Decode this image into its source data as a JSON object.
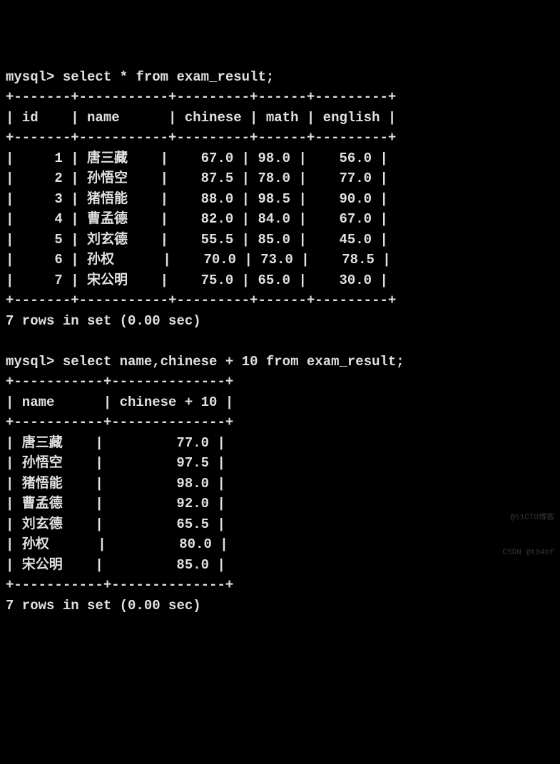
{
  "query1": {
    "prompt": "mysql> ",
    "sql": "select * from exam_result;",
    "border_top": "+-------+-----------+---------+------+---------+",
    "header_line": "| id    | name      | chinese | math | english |",
    "border_mid": "+-------+-----------+---------+------+---------+",
    "rows": [
      "|     1 | 唐三藏    |    67.0 | 98.0 |    56.0 |",
      "|     2 | 孙悟空    |    87.5 | 78.0 |    77.0 |",
      "|     3 | 猪悟能    |    88.0 | 98.5 |    90.0 |",
      "|     4 | 曹孟德    |    82.0 | 84.0 |    67.0 |",
      "|     5 | 刘玄德    |    55.5 | 85.0 |    45.0 |",
      "|     6 | 孙权      |    70.0 | 73.0 |    78.5 |",
      "|     7 | 宋公明    |    75.0 | 65.0 |    30.0 |"
    ],
    "border_bot": "+-------+-----------+---------+------+---------+",
    "status": "7 rows in set (0.00 sec)"
  },
  "query2": {
    "prompt": "mysql> ",
    "sql": "select name,chinese + 10 from exam_result;",
    "border_top": "+-----------+--------------+",
    "header_line": "| name      | chinese + 10 |",
    "border_mid": "+-----------+--------------+",
    "rows": [
      "| 唐三藏    |         77.0 |",
      "| 孙悟空    |         97.5 |",
      "| 猪悟能    |         98.0 |",
      "| 曹孟德    |         92.0 |",
      "| 刘玄德    |         65.5 |",
      "| 孙权      |         80.0 |",
      "| 宋公明    |         85.0 |"
    ],
    "border_bot": "+-----------+--------------+",
    "status": "7 rows in set (0.00 sec)"
  },
  "watermark": {
    "line1": "@51CTO博客",
    "line2": "CSDN @t04bf"
  },
  "chart_data": [
    {
      "type": "table",
      "title": "exam_result",
      "columns": [
        "id",
        "name",
        "chinese",
        "math",
        "english"
      ],
      "rows": [
        [
          1,
          "唐三藏",
          67.0,
          98.0,
          56.0
        ],
        [
          2,
          "孙悟空",
          87.5,
          78.0,
          77.0
        ],
        [
          3,
          "猪悟能",
          88.0,
          98.5,
          90.0
        ],
        [
          4,
          "曹孟德",
          82.0,
          84.0,
          67.0
        ],
        [
          5,
          "刘玄德",
          55.5,
          85.0,
          45.0
        ],
        [
          6,
          "孙权",
          70.0,
          73.0,
          78.5
        ],
        [
          7,
          "宋公明",
          75.0,
          65.0,
          30.0
        ]
      ]
    },
    {
      "type": "table",
      "title": "name, chinese + 10",
      "columns": [
        "name",
        "chinese + 10"
      ],
      "rows": [
        [
          "唐三藏",
          77.0
        ],
        [
          "孙悟空",
          97.5
        ],
        [
          "猪悟能",
          98.0
        ],
        [
          "曹孟德",
          92.0
        ],
        [
          "刘玄德",
          65.5
        ],
        [
          "孙权",
          80.0
        ],
        [
          "宋公明",
          85.0
        ]
      ]
    }
  ]
}
